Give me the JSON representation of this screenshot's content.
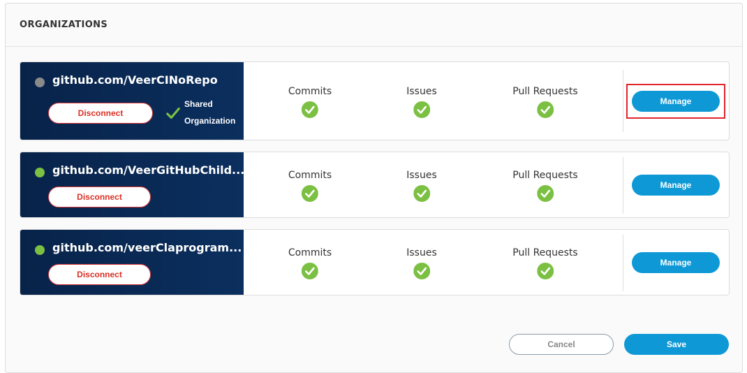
{
  "panel": {
    "title": "ORGANIZATIONS"
  },
  "metric_labels": {
    "commits": "Commits",
    "issues": "Issues",
    "pull_requests": "Pull Requests"
  },
  "organizations": [
    {
      "name": "github.com/VeerCINoRepo",
      "status_color": "#8a8a8a",
      "disconnect_label": "Disconnect",
      "shared_label": "Shared Organization",
      "manage_label": "Manage",
      "highlighted": true
    },
    {
      "name": "github.com/VeerGitHubChild...",
      "status_color": "#7bc043",
      "disconnect_label": "Disconnect",
      "manage_label": "Manage",
      "highlighted": false
    },
    {
      "name": "github.com/veerClaprogram...",
      "status_color": "#7bc043",
      "disconnect_label": "Disconnect",
      "manage_label": "Manage",
      "highlighted": false
    }
  ],
  "footer": {
    "cancel_label": "Cancel",
    "save_label": "Save"
  },
  "colors": {
    "accent": "#0e99d6",
    "success": "#7bc043",
    "danger": "#d93025",
    "card_dark": "#0b2f5e"
  },
  "icons": {
    "status": "check-circle-icon",
    "shared": "checkmark-icon"
  }
}
